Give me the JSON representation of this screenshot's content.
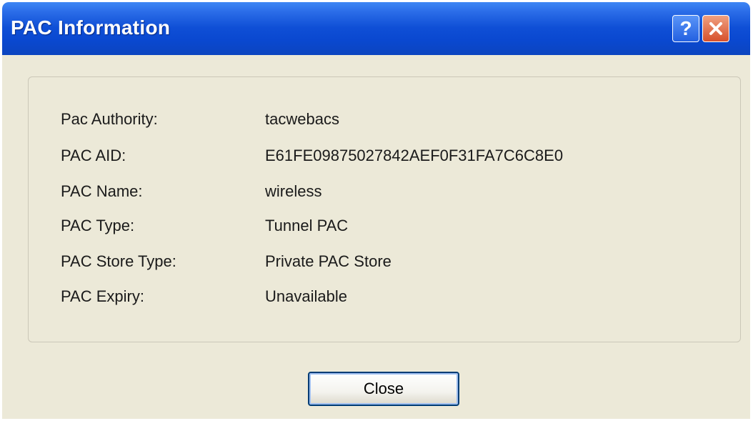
{
  "window": {
    "title": "PAC Information",
    "help_symbol": "?"
  },
  "pac_info": {
    "rows": [
      {
        "label": "Pac Authority:",
        "value": "tacwebacs"
      },
      {
        "label": "PAC AID:",
        "value": "E61FE09875027842AEF0F31FA7C6C8E0"
      },
      {
        "label": "PAC Name:",
        "value": "wireless"
      },
      {
        "label": "PAC Type:",
        "value": "Tunnel PAC"
      },
      {
        "label": "PAC Store Type:",
        "value": "Private PAC Store"
      },
      {
        "label": "PAC Expiry:",
        "value": "Unavailable"
      }
    ]
  },
  "buttons": {
    "close_label": "Close"
  },
  "colors": {
    "titlebar": "#0a48d0",
    "dialog_bg": "#ece9d8",
    "close_icon_bg": "#d6502c"
  }
}
